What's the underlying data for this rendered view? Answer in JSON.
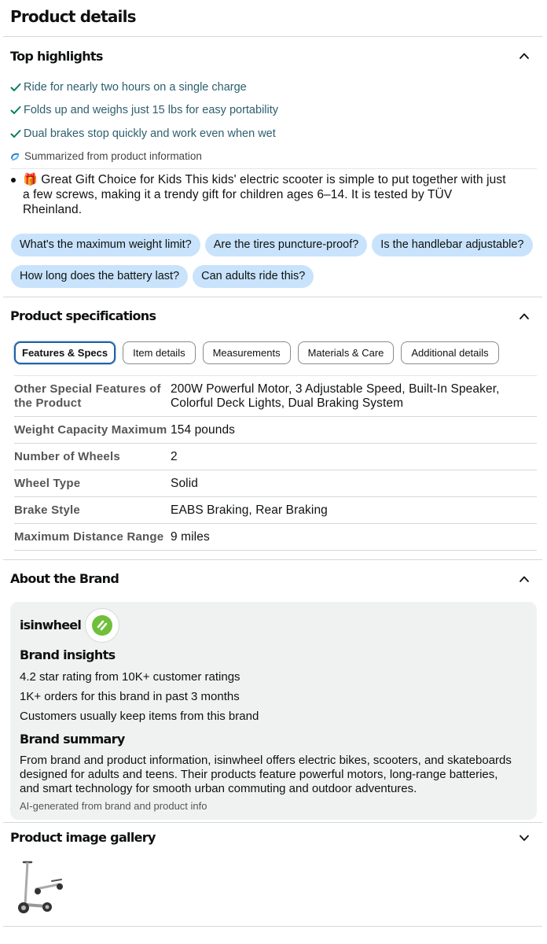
{
  "page_title": "Product details",
  "top_highlights": {
    "title": "Top highlights",
    "items": [
      "Ride for nearly two hours on a single charge",
      "Folds up and weighs just 15 lbs for easy portability",
      "Dual brakes stop quickly and work even when wet"
    ],
    "summary_note": "Summarized from product information",
    "bullet": "Great Gift Choice for Kids This kids' electric scooter is simple to put together with just a few screws, making it a trendy gift for children ages 6–14. It is tested by TÜV Rheinland.",
    "bullet_emoji": "🎁",
    "questions_row1": [
      "What's the maximum weight limit?",
      "Are the tires puncture-proof?",
      "Is the handlebar adjustable?"
    ],
    "questions_row2": [
      "How long does the battery last?",
      "Can adults ride this?"
    ]
  },
  "specs": {
    "title": "Product specifications",
    "tabs": [
      "Features & Specs",
      "Item details",
      "Measurements",
      "Materials & Care",
      "Additional details"
    ],
    "active_tab": "Features & Specs",
    "rows": [
      {
        "label": "Other Special Features of the Product",
        "value": "200W Powerful Motor, 3 Adjustable Speed, Built-In Speaker, Colorful Deck Lights, Dual Braking System"
      },
      {
        "label": "Weight Capacity Maximum",
        "value": "154 pounds"
      },
      {
        "label": "Number of Wheels",
        "value": "2"
      },
      {
        "label": "Wheel Type",
        "value": "Solid"
      },
      {
        "label": "Brake Style",
        "value": "EABS Braking, Rear Braking"
      },
      {
        "label": "Maximum Distance Range",
        "value": "9 miles"
      }
    ]
  },
  "brand": {
    "title": "About the Brand",
    "name": "isinwheel",
    "insights_title": "Brand insights",
    "insights": [
      "4.2 star rating from 10K+ customer ratings",
      "1K+ orders for this brand in past 3 months",
      "Customers usually keep items from this brand"
    ],
    "summary_title": "Brand summary",
    "summary": "From brand and product information, isinwheel offers electric bikes, scooters, and skateboards designed for adults and teens. Their products feature powerful motors, long-range batteries, and smart technology for smooth urban commuting and outdoor adventures.",
    "ai_note": "AI-generated from brand and product info"
  },
  "gallery": {
    "title": "Product image gallery"
  },
  "colors": {
    "accent_blue": "#2162a1",
    "check_green": "#067d62",
    "chip_blue": "#c8e3fb",
    "highlight_text": "#2d5f6e"
  }
}
